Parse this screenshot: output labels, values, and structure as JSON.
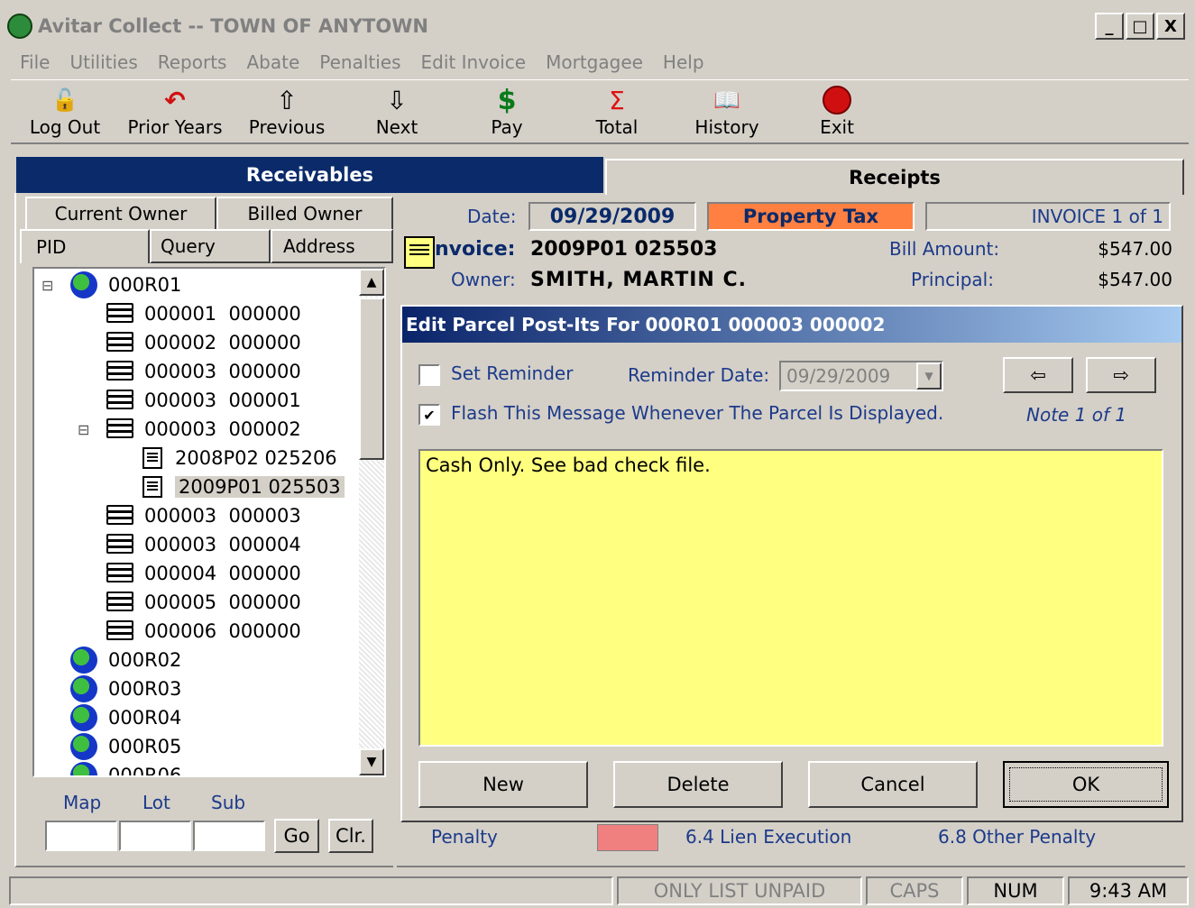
{
  "window": {
    "title": "Avitar Collect -- TOWN OF ANYTOWN",
    "min": "_",
    "max": "□",
    "close": "X"
  },
  "menu": [
    "File",
    "Utilities",
    "Reports",
    "Abate",
    "Penalties",
    "Edit Invoice",
    "Mortgagee",
    "Help"
  ],
  "toolbar": [
    {
      "label": "Log Out",
      "icon": "lock-icon",
      "glyph": "🔓"
    },
    {
      "label": "Prior Years",
      "icon": "undo-arrow-icon",
      "glyph": "↶"
    },
    {
      "label": "Previous",
      "icon": "up-arrow-icon",
      "glyph": "⇧"
    },
    {
      "label": "Next",
      "icon": "down-arrow-icon",
      "glyph": "⇩"
    },
    {
      "label": "Pay",
      "icon": "dollar-icon",
      "glyph": "$"
    },
    {
      "label": "Total",
      "icon": "sigma-icon",
      "glyph": "Σ"
    },
    {
      "label": "History",
      "icon": "book-icon",
      "glyph": "📖"
    },
    {
      "label": "Exit",
      "icon": "stop-icon",
      "glyph": ""
    }
  ],
  "tabs": {
    "receivables": "Receivables",
    "receipts": "Receipts"
  },
  "leftTabs": {
    "current_owner": "Current Owner",
    "billed_owner": "Billed Owner",
    "pid": "PID",
    "query": "Query",
    "address": "Address"
  },
  "tree": [
    {
      "type": "root",
      "text": "000R01",
      "indent": 0,
      "expand": "⊟"
    },
    {
      "type": "parcel",
      "text": "000001  000000",
      "indent": 1
    },
    {
      "type": "parcel",
      "text": "000002  000000",
      "indent": 1
    },
    {
      "type": "parcel",
      "text": "000003  000000",
      "indent": 1
    },
    {
      "type": "parcel",
      "text": "000003  000001",
      "indent": 1
    },
    {
      "type": "parcel",
      "text": "000003  000002",
      "indent": 1,
      "expand": "⊟"
    },
    {
      "type": "invoice",
      "text": "2008P02 025206",
      "indent": 2
    },
    {
      "type": "invoice",
      "text": "2009P01 025503",
      "indent": 2,
      "selected": true
    },
    {
      "type": "parcel",
      "text": "000003  000003",
      "indent": 1
    },
    {
      "type": "parcel",
      "text": "000003  000004",
      "indent": 1
    },
    {
      "type": "parcel",
      "text": "000004  000000",
      "indent": 1
    },
    {
      "type": "parcel",
      "text": "000005  000000",
      "indent": 1
    },
    {
      "type": "parcel",
      "text": "000006  000000",
      "indent": 1
    },
    {
      "type": "root",
      "text": "000R02",
      "indent": 0
    },
    {
      "type": "root",
      "text": "000R03",
      "indent": 0
    },
    {
      "type": "root",
      "text": "000R04",
      "indent": 0
    },
    {
      "type": "root",
      "text": "000R05",
      "indent": 0
    },
    {
      "type": "root",
      "text": "000R06",
      "indent": 0
    }
  ],
  "search": {
    "map": "Map",
    "lot": "Lot",
    "sub": "Sub",
    "go": "Go",
    "clear": "Clr."
  },
  "invoiceHeader": {
    "date_label": "Date:",
    "date": "09/29/2009",
    "tax_type": "Property Tax",
    "invoice_count": "INVOICE 1 of 1",
    "invoice_label": "nvoice:",
    "invoice": "2009P01 025503",
    "owner_label": "Owner:",
    "owner": "SMITH, MARTIN C.",
    "bill_amount_label": "Bill Amount:",
    "bill_amount": "$547.00",
    "principal_label": "Principal:",
    "principal": "$547.00"
  },
  "dialog": {
    "title": "Edit Parcel Post-Its For 000R01 000003 000002",
    "set_reminder": "Set Reminder",
    "reminder_date_label": "Reminder Date:",
    "reminder_date": "09/29/2009",
    "flash": "Flash This Message Whenever The Parcel Is Displayed.",
    "note": "Note 1 of 1",
    "message": "Cash Only. See bad check file.",
    "new": "New",
    "delete": "Delete",
    "cancel": "Cancel",
    "ok": "OK",
    "prev": "⇦",
    "next": "⇨",
    "check": "✔"
  },
  "legend": {
    "penalty": "Penalty",
    "lien": "6.4 Lien Execution",
    "other": "6.8 Other Penalty",
    "penalty_color": "#f08080"
  },
  "statusbar": {
    "unpaid": "ONLY LIST UNPAID",
    "caps": "CAPS",
    "num": "NUM",
    "time": "9:43 AM"
  },
  "colors": {
    "header_blue": "#0a2a6a",
    "dialog_yellow": "#ffff80",
    "property_tax_orange": "#ff8040"
  }
}
